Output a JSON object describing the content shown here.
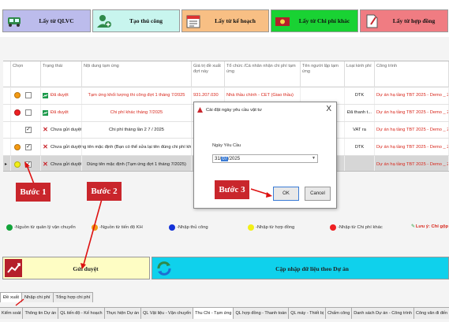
{
  "toolbar": {
    "buttons": [
      {
        "label": "Lấy từ QLVC",
        "icon": "truck-icon",
        "bg": "#bcbcec"
      },
      {
        "label": "Tạo thủ công",
        "icon": "add-user-icon",
        "bg": "#c8f5ee"
      },
      {
        "label": "Lấy từ kế hoạch",
        "icon": "calendar-icon",
        "bg": "#f8bf84"
      },
      {
        "label": "Lấy từ Chi phí khác",
        "icon": "money-icon",
        "bg": "#19d233"
      },
      {
        "label": "Lấy từ hợp đồng",
        "icon": "document-icon",
        "bg": "#f07c82"
      }
    ]
  },
  "grid": {
    "headers": [
      "Chọn",
      "Trạng thái",
      "Nội dung tạm ứng",
      "Giá trị đề xuất đợt này",
      "Tổ chức /Cá nhân nhận chi phí tạm ứng",
      "Tên người lập tạm ứng",
      "Loại kinh phí",
      "Công trình"
    ],
    "rows": [
      {
        "dot_color": "#f49a12",
        "checked": false,
        "status": "Đã duyệt",
        "status_type": "approved",
        "status_red": true,
        "content": "Tạm ứng khối lượng thi công đợt 1 tháng 7/2025",
        "content_red": true,
        "value": "931.207.030",
        "org": "Nhà thầu chính - CET (Giao thầu)",
        "creator": "",
        "funding": "DTK",
        "project": "Dự án hạ tầng TBT 2025 - Demo _ 2025",
        "selected": false
      },
      {
        "dot_color": "#ee1f22",
        "checked": false,
        "status": "Đã duyệt",
        "status_type": "approved",
        "status_red": true,
        "content": "Chi phí khác tháng 7/2025",
        "content_red": true,
        "value": "",
        "org": "",
        "creator": "",
        "funding": "Đã thanh t...",
        "project": "Dự án hạ tầng TBT 2025 - Demo _ 2025",
        "selected": false
      },
      {
        "dot_color": "",
        "checked": true,
        "status": "Chưa gửi duyệt",
        "status_type": "pending",
        "status_red": false,
        "content": "Chi phí tháng lần 2 7 / 2025",
        "content_red": false,
        "value": "",
        "org": "",
        "creator": "",
        "funding": "VAT ra",
        "project": "Dự án hạ tầng TBT 2025 - Demo _ 2025",
        "selected": false
      },
      {
        "dot_color": "#f49a12",
        "checked": true,
        "status": "Chưa gửi duyệt",
        "status_type": "pending",
        "status_red": false,
        "content": "Dùng tên mặc định (Bạn có thể sửa lại tên đúng chi phí khác)",
        "content_red": false,
        "value": "",
        "org": "",
        "creator": "",
        "funding": "DTK",
        "project": "Dự án hạ tầng TBT 2025 - Demo _ 2025",
        "selected": false
      },
      {
        "dot_color": "#f2ef16",
        "checked": true,
        "status": "Chưa gửi duyệt",
        "status_type": "pending",
        "status_red": false,
        "content": "Dùng tên mặc định (Tạm ứng đợt 1 tháng 7/2025)",
        "content_red": false,
        "value": "",
        "org": "",
        "creator": "",
        "funding": "",
        "project": "Dự án hạ tầng TBT 2025 - Demo _ 2025",
        "selected": true
      }
    ]
  },
  "legend": [
    {
      "color": "#12a43a",
      "label": "-Nguồn từ quản lý vận chuyển"
    },
    {
      "color": "#f49a12",
      "label": "-Nguồn từ tiến độ KH"
    },
    {
      "color": "#1432d8",
      "label": "-Nhập thủ công"
    },
    {
      "color": "#f2ef16",
      "label": "-Nhập từ hợp đồng"
    },
    {
      "color": "#ee1f22",
      "label": "-Nhập từ Chi phí khác"
    }
  ],
  "legend_save": "Lưu ý: Chỉ gộp",
  "actions": {
    "approve_label": "Gửi duyệt",
    "update_label": "Cập nhập dữ liệu theo Dự án"
  },
  "tabs_row1": [
    "Đề xuất",
    "Nhập chi phí",
    "Tổng hợp chi phí"
  ],
  "tabs_row2": [
    "Kiểm soát",
    "Thông tin Dự án",
    "QL tiến độ - Kế hoạch",
    "Thực hiện Dự án",
    "QL Vật liệu - Vận chuyển",
    "Thu Chi - Tạm ứng",
    "QL hợp đồng - Thanh toán",
    "QL máy - Thiết bị",
    "Chấm công",
    "Danh sách Dự án - Công trình",
    "Công văn đi đến"
  ],
  "tabs_row2_active": 5,
  "dialog": {
    "title": "Cài đặt ngày yêu cầu vật tư",
    "close": "X",
    "field_label": "Ngày Yêu Cầu",
    "date_prefix": "31/",
    "date_month": "07",
    "date_suffix": "/2025",
    "ok_label": "OK",
    "cancel_label": "Cancel"
  },
  "steps": [
    "Bước 1",
    "Bước 2",
    "Bước 3"
  ]
}
